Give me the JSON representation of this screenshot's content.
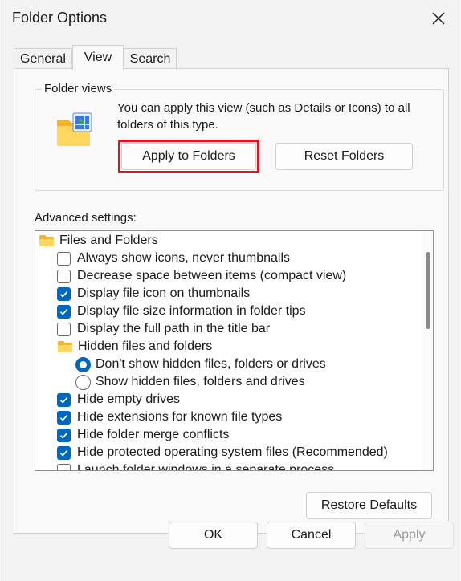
{
  "window": {
    "title": "Folder Options"
  },
  "tabs": [
    {
      "label": "General",
      "active": false
    },
    {
      "label": "View",
      "active": true
    },
    {
      "label": "Search",
      "active": false
    }
  ],
  "folder_views": {
    "legend": "Folder views",
    "description": "You can apply this view (such as Details or Icons) to all folders of this type.",
    "apply_button": "Apply to Folders",
    "reset_button": "Reset Folders",
    "highlight_color": "#e0141c"
  },
  "advanced": {
    "label": "Advanced settings:",
    "items": [
      {
        "kind": "folder",
        "label": "Files and Folders",
        "level": 0
      },
      {
        "kind": "checkbox",
        "label": "Always show icons, never thumbnails",
        "checked": false,
        "level": 1
      },
      {
        "kind": "checkbox",
        "label": "Decrease space between items (compact view)",
        "checked": false,
        "level": 1
      },
      {
        "kind": "checkbox",
        "label": "Display file icon on thumbnails",
        "checked": true,
        "level": 1
      },
      {
        "kind": "checkbox",
        "label": "Display file size information in folder tips",
        "checked": true,
        "level": 1
      },
      {
        "kind": "checkbox",
        "label": "Display the full path in the title bar",
        "checked": false,
        "level": 1
      },
      {
        "kind": "folder",
        "label": "Hidden files and folders",
        "level": 1
      },
      {
        "kind": "radio",
        "label": "Don't show hidden files, folders or drives",
        "checked": true,
        "level": 2
      },
      {
        "kind": "radio",
        "label": "Show hidden files, folders and drives",
        "checked": false,
        "level": 2
      },
      {
        "kind": "checkbox",
        "label": "Hide empty drives",
        "checked": true,
        "level": 1
      },
      {
        "kind": "checkbox",
        "label": "Hide extensions for known file types",
        "checked": true,
        "level": 1
      },
      {
        "kind": "checkbox",
        "label": "Hide folder merge conflicts",
        "checked": true,
        "level": 1
      },
      {
        "kind": "checkbox",
        "label": "Hide protected operating system files (Recommended)",
        "checked": true,
        "level": 1
      },
      {
        "kind": "checkbox",
        "label": "Launch folder windows in a separate process",
        "checked": false,
        "level": 1
      }
    ],
    "restore_button": "Restore Defaults"
  },
  "footer": {
    "ok": "OK",
    "cancel": "Cancel",
    "apply": "Apply"
  },
  "colors": {
    "accent": "#0067c0",
    "folder": "#ffc83d"
  }
}
